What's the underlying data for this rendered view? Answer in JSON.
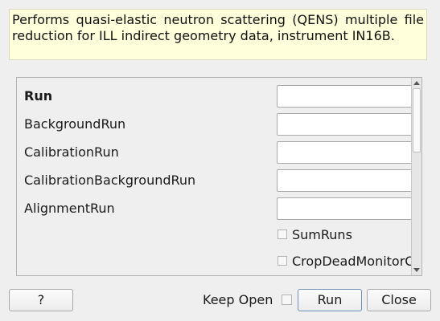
{
  "description": "Performs quasi-elastic neutron scattering (QENS) multiple file reduction for ILL indirect geometry data, instrument IN16B.",
  "properties": [
    {
      "label": "Run",
      "value": ""
    },
    {
      "label": "BackgroundRun",
      "value": ""
    },
    {
      "label": "CalibrationRun",
      "value": ""
    },
    {
      "label": "CalibrationBackgroundRun",
      "value": ""
    },
    {
      "label": "AlignmentRun",
      "value": ""
    }
  ],
  "checkboxes": [
    {
      "label": "SumRuns",
      "checked": false
    },
    {
      "label": "CropDeadMonitorChannels",
      "checked": false
    }
  ],
  "buttons": {
    "help": "?",
    "keep_open": "Keep Open",
    "run": "Run",
    "close": "Close"
  },
  "keep_open_checked": false
}
